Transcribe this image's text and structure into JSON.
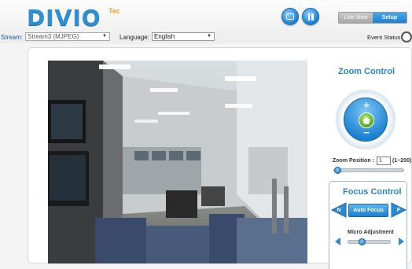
{
  "header": {
    "logo": "DIVIO",
    "logo_suffix": "Tec",
    "tabs": [
      {
        "label": "Live View",
        "active": false
      },
      {
        "label": "Setup",
        "active": true
      }
    ],
    "snapshot_icon": "camera-icon",
    "pause_icon": "pause-icon"
  },
  "toolbar": {
    "stream_label": "Stream:",
    "stream_value": "Stream3 (MJPEG)",
    "language_label": "Language:",
    "language_value": "English",
    "event_status_label": "Event Status"
  },
  "zoom": {
    "title": "Zoom Control",
    "plus": "+",
    "minus": "−",
    "position_label": "Zoom Position :",
    "position_value": "1",
    "range_label": "(1~200)",
    "slider_level": 0.0
  },
  "focus": {
    "title": "Focus Control",
    "near_label": "N",
    "far_label": "F",
    "auto_focus_label": "Auto Focus",
    "micro_label": "Micro Adjustment",
    "micro_level": 0.3
  },
  "colors": {
    "brand_blue": "#2a86c9",
    "accent_green": "#4ba316"
  }
}
